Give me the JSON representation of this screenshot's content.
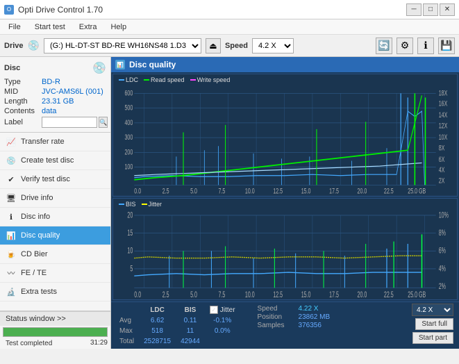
{
  "titlebar": {
    "title": "Opti Drive Control 1.70",
    "min_btn": "─",
    "max_btn": "□",
    "close_btn": "✕"
  },
  "menubar": {
    "items": [
      "File",
      "Start test",
      "Extra",
      "Help"
    ]
  },
  "drive_toolbar": {
    "drive_label": "Drive",
    "drive_value": "(G:)  HL-DT-ST BD-RE  WH16NS48 1.D3",
    "speed_label": "Speed",
    "speed_value": "4.2 X"
  },
  "disc_panel": {
    "title": "Disc",
    "type_label": "Type",
    "type_value": "BD-R",
    "mid_label": "MID",
    "mid_value": "JVC-AMS6L (001)",
    "length_label": "Length",
    "length_value": "23.31 GB",
    "contents_label": "Contents",
    "contents_value": "data",
    "label_label": "Label"
  },
  "nav_items": [
    {
      "id": "transfer-rate",
      "label": "Transfer rate",
      "active": false
    },
    {
      "id": "create-test-disc",
      "label": "Create test disc",
      "active": false
    },
    {
      "id": "verify-test-disc",
      "label": "Verify test disc",
      "active": false
    },
    {
      "id": "drive-info",
      "label": "Drive info",
      "active": false
    },
    {
      "id": "disc-info",
      "label": "Disc info",
      "active": false
    },
    {
      "id": "disc-quality",
      "label": "Disc quality",
      "active": true
    },
    {
      "id": "cd-bier",
      "label": "CD Bier",
      "active": false
    },
    {
      "id": "fe-te",
      "label": "FE / TE",
      "active": false
    },
    {
      "id": "extra-tests",
      "label": "Extra tests",
      "active": false
    }
  ],
  "status": {
    "window_btn": "Status window >>",
    "progress_pct": 100,
    "status_text": "Test completed",
    "time": "31:29"
  },
  "disc_quality": {
    "title": "Disc quality",
    "chart1": {
      "legend": [
        {
          "label": "LDC",
          "color": "#44aaff"
        },
        {
          "label": "Read speed",
          "color": "#00ff00"
        },
        {
          "label": "Write speed",
          "color": "#ff44ff"
        }
      ],
      "y_labels": [
        "600",
        "500",
        "400",
        "300",
        "200",
        "100",
        ""
      ],
      "y_labels_right": [
        "18X",
        "16X",
        "14X",
        "12X",
        "10X",
        "8X",
        "6X",
        "4X",
        "2X"
      ],
      "x_labels": [
        "0.0",
        "2.5",
        "5.0",
        "7.5",
        "10.0",
        "12.5",
        "15.0",
        "17.5",
        "20.0",
        "22.5",
        "25.0 GB"
      ]
    },
    "chart2": {
      "legend": [
        {
          "label": "BIS",
          "color": "#44aaff"
        },
        {
          "label": "Jitter",
          "color": "#ffff00"
        }
      ],
      "y_labels": [
        "20",
        "15",
        "10",
        "5",
        ""
      ],
      "y_labels_right": [
        "10%",
        "8%",
        "6%",
        "4%",
        "2%"
      ],
      "x_labels": [
        "0.0",
        "2.5",
        "5.0",
        "7.5",
        "10.0",
        "12.5",
        "15.0",
        "17.5",
        "20.0",
        "22.5",
        "25.0 GB"
      ]
    },
    "stats": {
      "ldc_header": "LDC",
      "bis_header": "BIS",
      "jitter_header": "Jitter",
      "avg_label": "Avg",
      "max_label": "Max",
      "total_label": "Total",
      "avg_ldc": "6.62",
      "avg_bis": "0.11",
      "avg_jitter": "-0.1%",
      "max_ldc": "518",
      "max_bis": "11",
      "max_jitter": "0.0%",
      "total_ldc": "2528715",
      "total_bis": "42944",
      "speed_label": "Speed",
      "speed_value": "4.22 X",
      "position_label": "Position",
      "position_value": "23862 MB",
      "samples_label": "Samples",
      "samples_value": "376356",
      "speed_dropdown": "4.2 X",
      "start_full_btn": "Start full",
      "start_part_btn": "Start part"
    }
  },
  "colors": {
    "accent_blue": "#4a8fd4",
    "chart_bg": "#1e3a5f",
    "ldc_color": "#44aaff",
    "speed_color": "#00ee00",
    "bis_color": "#44aaff",
    "jitter_color": "#ffff00",
    "active_nav": "#3c9ddf"
  }
}
